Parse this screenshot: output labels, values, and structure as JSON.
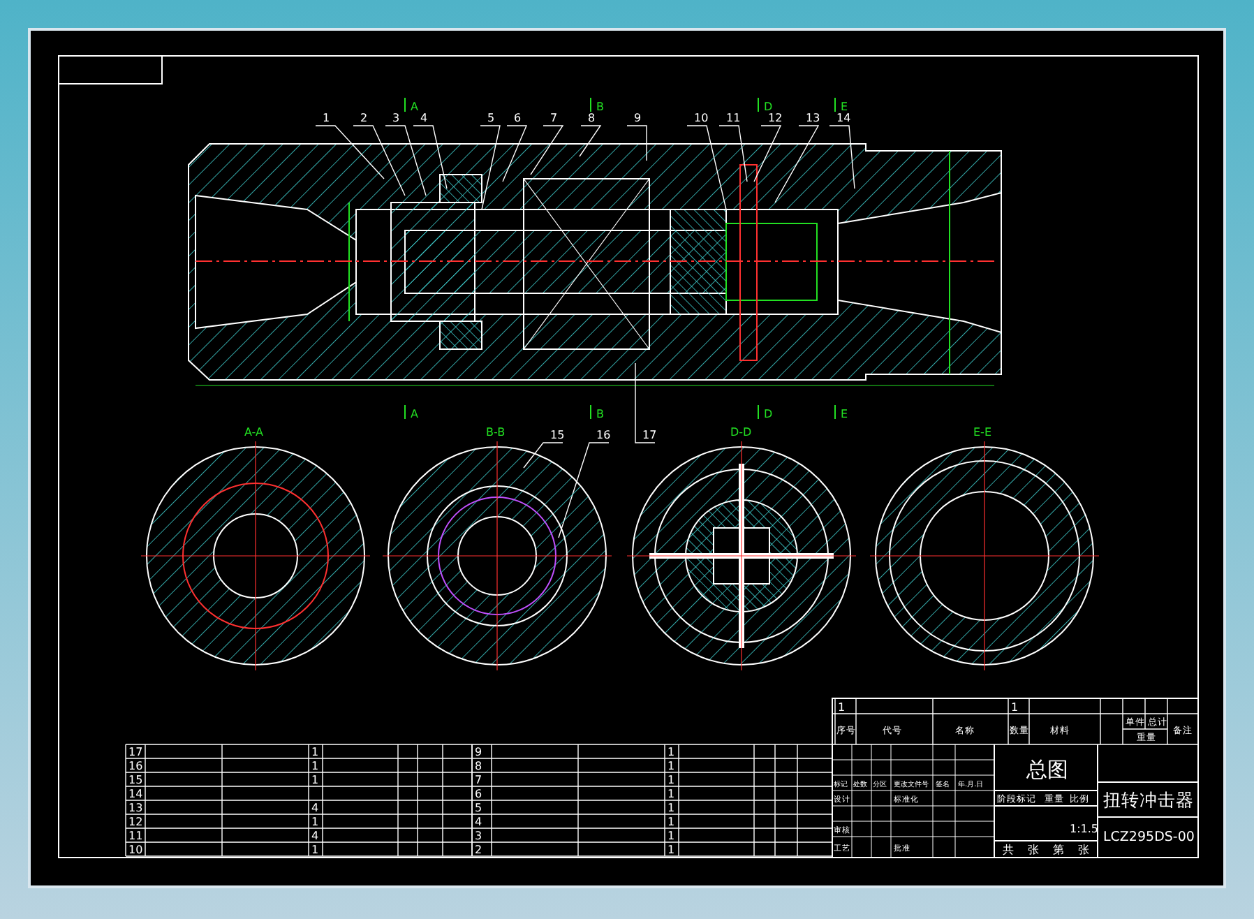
{
  "balloons": [
    {
      "label": "1"
    },
    {
      "label": "2"
    },
    {
      "label": "3"
    },
    {
      "label": "4"
    },
    {
      "label": "5"
    },
    {
      "label": "6"
    },
    {
      "label": "7"
    },
    {
      "label": "8"
    },
    {
      "label": "9"
    },
    {
      "label": "10"
    },
    {
      "label": "11"
    },
    {
      "label": "12"
    },
    {
      "label": "13"
    },
    {
      "label": "14"
    },
    {
      "label": "15"
    },
    {
      "label": "16"
    },
    {
      "label": "17"
    }
  ],
  "section_marks_top": [
    {
      "label": "A"
    },
    {
      "label": "B"
    },
    {
      "label": "D"
    },
    {
      "label": "E"
    }
  ],
  "section_marks_bottom": [
    {
      "label": "A"
    },
    {
      "label": "B"
    },
    {
      "label": "D"
    },
    {
      "label": "E"
    }
  ],
  "section_views": [
    {
      "title": "A-A"
    },
    {
      "title": "B-B"
    },
    {
      "title": "D-D"
    },
    {
      "title": "E-E"
    }
  ],
  "parts_list": {
    "left_rows": [
      {
        "number": "17",
        "quantity": "1"
      },
      {
        "number": "16",
        "quantity": "1"
      },
      {
        "number": "15",
        "quantity": "1"
      },
      {
        "number": "14",
        "quantity": ""
      },
      {
        "number": "13",
        "quantity": "4"
      },
      {
        "number": "12",
        "quantity": "1"
      },
      {
        "number": "11",
        "quantity": "4"
      },
      {
        "number": "10",
        "quantity": "1"
      }
    ],
    "right_rows": [
      {
        "number": "9",
        "quantity": "1"
      },
      {
        "number": "8",
        "quantity": "1"
      },
      {
        "number": "7",
        "quantity": "1"
      },
      {
        "number": "6",
        "quantity": "1"
      },
      {
        "number": "5",
        "quantity": "1"
      },
      {
        "number": "4",
        "quantity": "1"
      },
      {
        "number": "3",
        "quantity": "1"
      },
      {
        "number": "2",
        "quantity": "1"
      }
    ]
  },
  "title_block": {
    "first_row": {
      "number": "1",
      "quantity": "1"
    },
    "headers": [
      "序号",
      "代号",
      "名称",
      "数量",
      "材料",
      "单件",
      "总计",
      "重量",
      "备注"
    ],
    "revision_headers": [
      "标记",
      "处数",
      "分区",
      "更改文件号",
      "签名",
      "年.月.日"
    ],
    "signature_labels": [
      "设计",
      "标准化",
      "审核",
      "工艺",
      "批准"
    ],
    "stage_headers": [
      "阶段标记",
      "重量",
      "比例"
    ],
    "scale": "1:1.5",
    "sheet_count": [
      "共",
      "张",
      "第",
      "张"
    ],
    "drawing_type": "总图",
    "drawing_title": "扭转冲击器",
    "drawing_number": "LCZ295DS-00"
  }
}
